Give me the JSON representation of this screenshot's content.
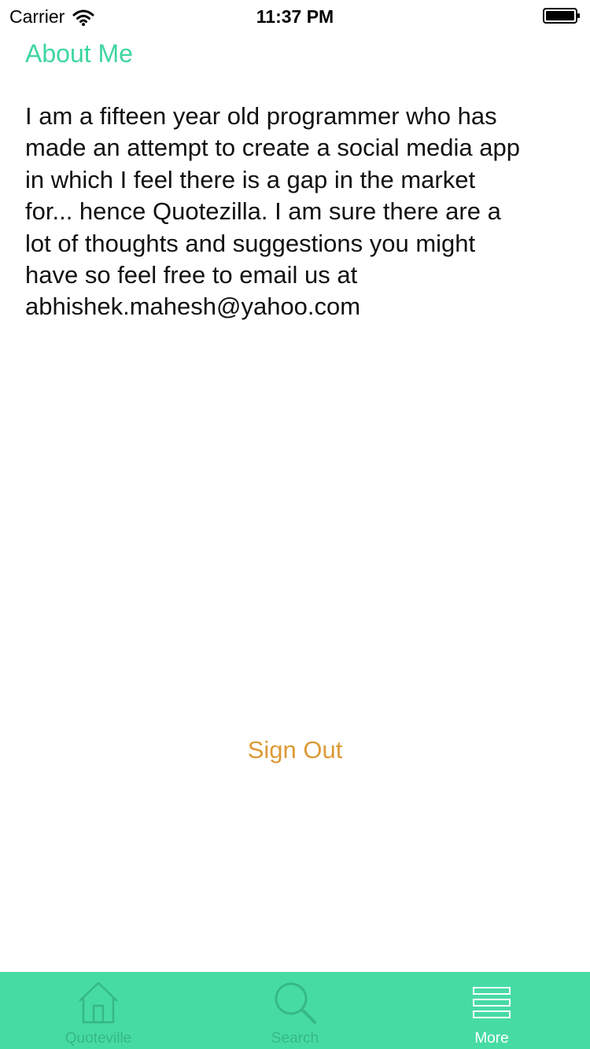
{
  "status_bar": {
    "carrier": "Carrier",
    "time": "11:37 PM",
    "wifi_icon": "wifi-icon",
    "battery_icon": "battery-icon"
  },
  "about": {
    "title": "About Me",
    "body": "I am a fifteen year old programmer who has made an attempt to create a social media app in which I feel there is a gap in the market for... hence Quotezilla. I am sure there are a lot of thoughts and suggestions you might have so feel free to email us at abhishek.mahesh@yahoo.com"
  },
  "actions": {
    "sign_out": "Sign Out"
  },
  "tab_bar": {
    "tabs": [
      {
        "label": "Quoteville",
        "icon": "house-icon",
        "active": false
      },
      {
        "label": "Search",
        "icon": "magnifier-icon",
        "active": false
      },
      {
        "label": "More",
        "icon": "menu-lines-icon",
        "active": true
      }
    ]
  },
  "colors": {
    "accent": "#3ed69f",
    "tab_bar_bg": "#47dba4",
    "sign_out": "#dc9a36",
    "tab_inactive": "#36b886",
    "tab_active": "#ffffff"
  }
}
